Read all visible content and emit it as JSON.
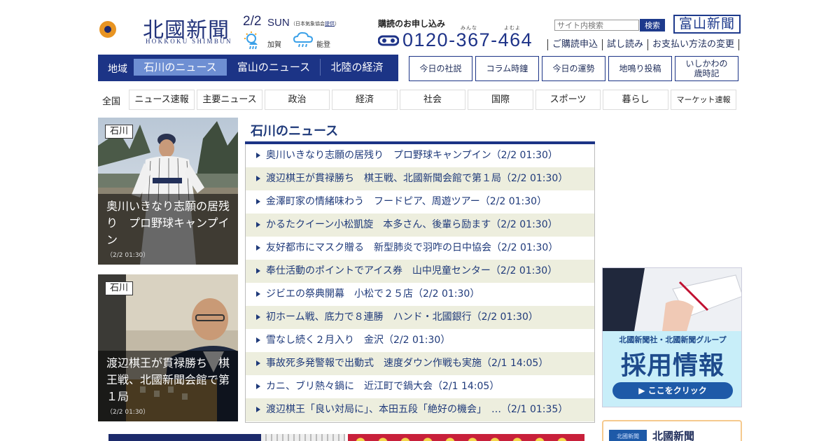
{
  "header": {
    "logo_title": "北國新聞",
    "logo_sub": "HOKKOKU SHIMBUN",
    "date": "2/2",
    "day": "SUN",
    "weather_src_prefix": "（日本気象協会",
    "weather_src_link": "提供",
    "weather_src_suffix": "）",
    "weather": [
      {
        "label": "加賀",
        "icon": "sun-rain-icon"
      },
      {
        "label": "能登",
        "icon": "cloud-rain-icon"
      }
    ],
    "subscribe_title": "購読のお申し込み",
    "ruby_1": "みんな",
    "ruby_2": "よむよ",
    "phone": "0120-367-464",
    "search_placeholder": "サイト内検索",
    "search_button": "検索",
    "toyama_logo": "富山新聞",
    "util_links": [
      "ご購読申込",
      "試し読み",
      "お支払い方法の変更"
    ]
  },
  "region_nav": {
    "label": "地域",
    "tabs": [
      "石川のニュース",
      "富山のニュース",
      "北陸の経済"
    ],
    "active": 0
  },
  "box_links": [
    {
      "label": "今日の社説"
    },
    {
      "label": "コラム時鐘"
    },
    {
      "label": "今日の運勢"
    },
    {
      "label": "地鳴り投稿"
    },
    {
      "label": "いしかわの\n歳時記"
    }
  ],
  "categories": {
    "all_label": "全国",
    "items": [
      "ニュース速報",
      "主要ニュース",
      "政治",
      "経済",
      "社会",
      "国際",
      "スポーツ",
      "暮らし",
      "マーケット速報"
    ]
  },
  "cards": [
    {
      "tag": "石川",
      "title": "奥川いきなり志願の居残り　プロ野球キャンプイン",
      "date": "（2/2 01:30）"
    },
    {
      "tag": "石川",
      "title": "渡辺棋王が貫禄勝ち　棋王戦、北國新聞会館で第１局",
      "date": "（2/2 01:30）"
    }
  ],
  "news": {
    "heading": "石川のニュース",
    "items": [
      "奥川いきなり志願の居残り　プロ野球キャンプイン（2/2 01:30）",
      "渡辺棋王が貫禄勝ち　棋王戦、北國新聞会館で第１局（2/2 01:30）",
      "金澤町家の情緒味わう　フードピア、周遊ツアー（2/2 01:30）",
      "かるたクイーン小松凱旋　本多さん、後輩ら励ます（2/2 01:30）",
      "友好都市にマスク贈る　新型肺炎で羽咋の日中協会（2/2 01:30）",
      "奉仕活動のポイントでアイス券　山中児童センター（2/2 01:30）",
      "ジビエの祭典開幕　小松で２５店（2/2 01:30）",
      "初ホーム戦、底力で８連勝　ハンド・北國銀行（2/2 01:30）",
      "雪なし続く２月入り　金沢（2/2 01:30）",
      "事故死多発警報で出動式　速度ダウン作戦も実施（2/1 14:05）",
      "カニ、ブリ熱々鍋に　近江町で鍋大会（2/1 14:05）",
      "渡辺棋王「良い対局に」、本田五段「絶好の機会」　…（2/1 01:35）"
    ]
  },
  "sidebar": {
    "recruit_sub": "北國新聞社・北國新聞グループ",
    "recruit_main": "採用情報",
    "recruit_button": "▶ ここをクリック",
    "box_badge": "北國新聞",
    "box_title": "北國新聞"
  },
  "colors": {
    "navy": "#1c3486",
    "link": "#1f3a7a",
    "row_alt": "#edeede"
  }
}
